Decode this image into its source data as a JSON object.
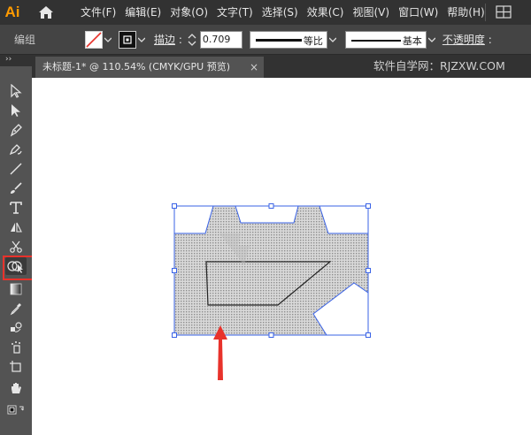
{
  "app": {
    "logo": "Ai",
    "home_icon": "home-icon"
  },
  "menu": [
    "文件(F)",
    "编辑(E)",
    "对象(O)",
    "文字(T)",
    "选择(S)",
    "效果(C)",
    "视图(V)",
    "窗口(W)",
    "帮助(H)"
  ],
  "control_bar": {
    "selection_label": "编组",
    "stroke_label": "描边",
    "stroke_weight": "0.709",
    "profile_label": "等比",
    "brush_label": "基本",
    "opacity_label": "不透明度"
  },
  "document_tab": {
    "title": "未标题-1* @ 110.54% (CMYK/GPU 预览)",
    "close_icon": "×"
  },
  "watermark": "软件自学网：RJZXW.COM",
  "tools": [
    "selection-tool-icon",
    "direct-selection-tool-icon",
    "pen-tool-icon",
    "curvature-tool-icon",
    "line-tool-icon",
    "paintbrush-tool-icon",
    "type-tool-icon",
    "reflect-tool-icon",
    "scissors-tool-icon",
    "shape-builder-tool-icon",
    "gradient-tool-icon",
    "eyedropper-tool-icon",
    "blend-tool-icon",
    "symbol-sprayer-tool-icon",
    "artboard-tool-icon",
    "hand-tool-icon",
    "fill-stroke-icon"
  ],
  "colors": {
    "selection_blue": "#3a63e6",
    "highlight_red": "#e8322b",
    "shape_fill": "#c8c8c8",
    "ui_dark": "#323232",
    "ui_panel": "#535353"
  }
}
